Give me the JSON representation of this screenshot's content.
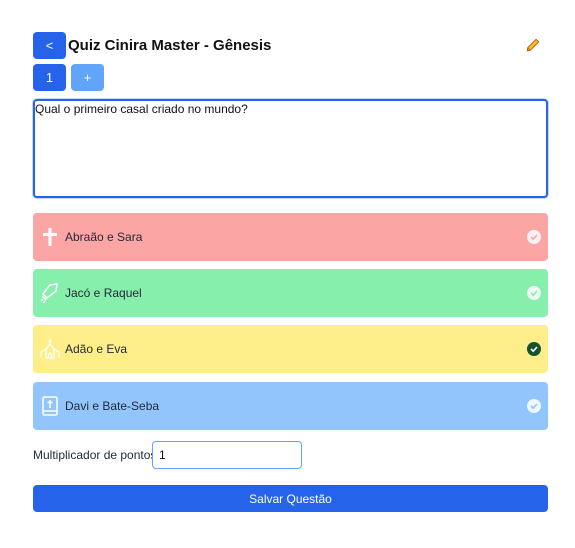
{
  "header": {
    "back_label": "<",
    "title": "Quiz Cinira Master - Gênesis",
    "edit_icon": "pencil-icon"
  },
  "question_nav": {
    "current": "1",
    "add_label": "+"
  },
  "question": {
    "text": "Qual o primeiro casal criado no mundo?"
  },
  "answers": [
    {
      "label": "Abraão e Sara",
      "icon": "cross-icon",
      "color": "#fca5a5",
      "correct": false
    },
    {
      "label": "Jacó e Raquel",
      "icon": "sword-icon",
      "color": "#86efac",
      "correct": false
    },
    {
      "label": "Adão e Eva",
      "icon": "church-icon",
      "color": "#fdee8a",
      "correct": true
    },
    {
      "label": "Davi e Bate-Seba",
      "icon": "bible-icon",
      "color": "#93c5fd",
      "correct": false
    }
  ],
  "multiplier": {
    "label": "Multiplicador de pontos:",
    "value": "1"
  },
  "save_label": "Salvar Questão",
  "colors": {
    "primary": "#2563eb",
    "primary_light": "#60a5fa",
    "correct_check": "#14532d"
  }
}
